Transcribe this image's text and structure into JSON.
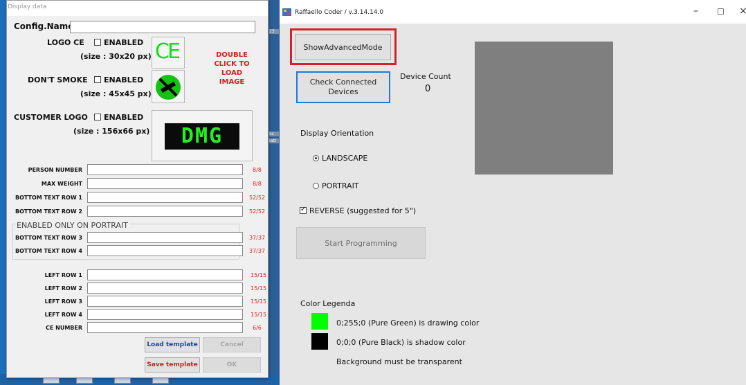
{
  "dialog": {
    "title": "Display data",
    "config_name_label": "Config.Name",
    "config_name_value": "",
    "logo_ce": {
      "label": "LOGO CE",
      "enabled_label": "ENABLED",
      "size": "(size : 30x20 px)",
      "glyph": "CE"
    },
    "dont_smoke": {
      "label": "DON'T SMOKE",
      "enabled_label": "ENABLED",
      "size": "(size : 45x45 px)"
    },
    "customer_logo": {
      "label": "CUSTOMER LOGO",
      "enabled_label": "ENABLED",
      "size": "(size : 156x66 px)",
      "glyph": "DMG"
    },
    "load_hint": [
      "DOUBLE",
      "CLICK TO",
      "LOAD",
      "IMAGE"
    ],
    "fields": [
      {
        "label": "PERSON NUMBER",
        "value": "",
        "counter": "8/8"
      },
      {
        "label": "MAX WEIGHT",
        "value": "",
        "counter": "8/8"
      },
      {
        "label": "BOTTOM TEXT ROW 1",
        "value": "",
        "counter": "52/52"
      },
      {
        "label": "BOTTOM TEXT ROW 2",
        "value": "",
        "counter": "52/52"
      }
    ],
    "portrait_group": {
      "title": "ENABLED ONLY ON PORTRAIT",
      "fields": [
        {
          "label": "BOTTOM TEXT ROW 3",
          "value": "",
          "counter": "37/37"
        },
        {
          "label": "BOTTOM TEXT ROW 4",
          "value": "",
          "counter": "37/37"
        }
      ]
    },
    "left_fields": [
      {
        "label": "LEFT ROW 1",
        "value": "",
        "counter": "15/15"
      },
      {
        "label": "LEFT ROW 2",
        "value": "",
        "counter": "15/15"
      },
      {
        "label": "LEFT ROW 3",
        "value": "",
        "counter": "15/15"
      },
      {
        "label": "LEFT ROW 4",
        "value": "",
        "counter": "15/15"
      },
      {
        "label": "CE NUMBER",
        "value": "",
        "counter": "6/6"
      }
    ],
    "buttons": {
      "load_template": "Load template",
      "cancel": "Cancel",
      "save_template": "Save template",
      "ok": "OK"
    }
  },
  "desktop": {
    "strip_texts": [
      "23",
      "Sc",
      "iatt"
    ]
  },
  "main": {
    "title": "Raffaello Coder / v.3.14.14.0",
    "controls": {
      "minimize": "–",
      "maximize": "☐",
      "close": "×"
    },
    "show_advanced": "ShowAdvancedMode",
    "check_devices": "Check Connected Devices",
    "device_count_label": "Device Count",
    "device_count_value": "0",
    "display_orientation": "Display Orientation",
    "landscape": "LANDSCAPE",
    "portrait": "PORTRAIT",
    "reverse": "REVERSE (suggested for 5\")",
    "start_programming": "Start Programming",
    "color_legenda": "Color Legenda",
    "legend": [
      {
        "color": "#00ff00",
        "text": "0;255;0 (Pure Green) is drawing color"
      },
      {
        "color": "#000000",
        "text": "0;0;0 (Pure Black) is shadow color"
      }
    ],
    "background_note": "Background must be transparent",
    "preview_color": "#7f7f7f",
    "highlight_color": "#d9202a"
  }
}
